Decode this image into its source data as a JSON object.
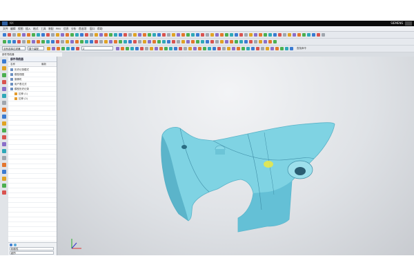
{
  "window": {
    "title": "NX",
    "brand": "SIEMENS"
  },
  "menu": [
    "文件",
    "编辑",
    "视图",
    "插入",
    "格式",
    "工具",
    "装配",
    "PMI",
    "信息",
    "分析",
    "首选项",
    "窗口",
    "帮助"
  ],
  "selection_bar": {
    "filter_value": "没有选择过滤器",
    "scope_value": "整个装配",
    "snap_label": "Z",
    "search_label": "查找命令"
  },
  "navigator": {
    "tab_label": "部件导航器",
    "panel_title": "部件导航器",
    "columns": [
      "名称",
      "最新"
    ],
    "tree": [
      {
        "label": "历史记录模式",
        "indent": 0
      },
      {
        "label": "模型视图",
        "indent": 0
      },
      {
        "label": "摄像机",
        "indent": 0
      },
      {
        "label": "用户表达式",
        "indent": 0
      },
      {
        "label": "模型历史记录",
        "indent": 0
      },
      {
        "label": "拉伸 (1)",
        "indent": 1
      },
      {
        "label": "拉伸 (2)",
        "indent": 1
      }
    ],
    "footer_rows": [
      "相依性",
      "细节"
    ]
  },
  "colors": {
    "part_surface": "#7fd3e3",
    "part_shadow": "#4fa9c1",
    "highlight": "#e8e84a",
    "titlebar": "#0b0b0b"
  },
  "icons": [
    "nx-logo-icon",
    "window-controls-icon",
    "triad-axes-icon",
    "tree-expand-icon",
    "part-feature-icon"
  ]
}
